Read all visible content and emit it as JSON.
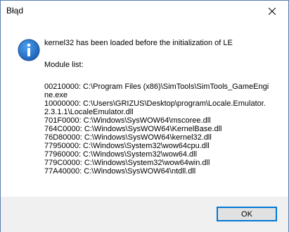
{
  "window": {
    "title": "Błąd",
    "close_icon": "close-icon"
  },
  "dialog": {
    "icon": "info-icon",
    "heading": "kernel32 has been loaded before the initialization of LE",
    "module_list_label": "Module list:",
    "modules": [
      "00210000: C:\\Program Files (x86)\\SimTools\\SimTools_GameEngine.exe",
      "10000000: C:\\Users\\GRIZUS\\Desktop\\program\\Locale.Emulator.2.3.1.1\\LocaleEmulator.dll",
      "701F0000: C:\\Windows\\SysWOW64\\mscoree.dll",
      "764C0000: C:\\Windows\\SysWOW64\\KernelBase.dll",
      "76D80000: C:\\Windows\\SysWOW64\\kernel32.dll",
      "77950000: C:\\Windows\\System32\\wow64cpu.dll",
      "77960000: C:\\Windows\\System32\\wow64.dll",
      "779C0000: C:\\Windows\\System32\\wow64win.dll",
      "77A40000: C:\\Windows\\SysWOW64\\ntdll.dll"
    ]
  },
  "footer": {
    "ok_label": "OK"
  }
}
